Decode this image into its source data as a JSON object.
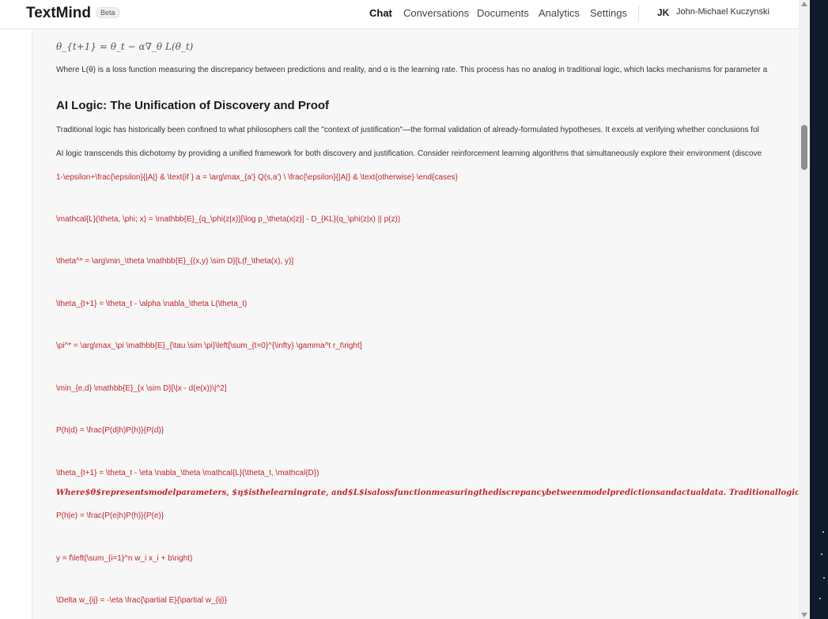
{
  "header": {
    "brand": "TextMind",
    "badge": "Beta",
    "nav": [
      {
        "label": "Chat",
        "active": true
      },
      {
        "label": "Conversations",
        "active": false
      },
      {
        "label": "Documents",
        "active": false
      },
      {
        "label": "Analytics",
        "active": false
      },
      {
        "label": "Settings",
        "active": false
      }
    ],
    "user_initials": "JK",
    "user_name": "John-Michael Kuczynski"
  },
  "content": {
    "update_formula": "θ_{t+1} = θ_t − α∇_θ L(θ_t)",
    "para_loss": "Where L(θ) is a loss function measuring the discrepancy between predictions and reality, and α is the learning rate. This process has no analog in traditional logic, which lacks mechanisms for parameter a",
    "heading": "AI Logic: The Unification of Discovery and Proof",
    "para_traditional": "Traditional logic has historically been confined to what philosophers call the \"context of justification\"—the formal validation of already-formulated hypotheses. It excels at verifying whether conclusions fol",
    "para_ai": "AI logic transcends this dichotomy by providing a unified framework for both discovery and justification. Consider reinforcement learning algorithms that simultaneously explore their environment (discove",
    "raw_lines": [
      "1-\\epsilon+\\frac{\\epsilon}{|A|} & \\text{if } a = \\arg\\max_{a'} Q(s,a') \\ \\frac{\\epsilon}{|A|} & \\text{otherwise} \\end{cases}",
      "\\mathcal{L}(\\theta, \\phi; x) = \\mathbb{E}_{q_\\phi(z|x)}[\\log p_\\theta(x|z)] - D_{KL}(q_\\phi(z|x) || p(z))",
      "\\theta^* = \\arg\\min_\\theta \\mathbb{E}_{(x,y) \\sim D}[L(f_\\theta(x), y)]",
      "\\theta_{t+1} = \\theta_t - \\alpha \\nabla_\\theta L(\\theta_t)",
      "\\pi^* = \\arg\\max_\\pi \\mathbb{E}_{\\tau \\sim \\pi}\\left[\\sum_{t=0}^{\\infty} \\gamma^t r_t\\right]",
      "\\min_{e,d} \\mathbb{E}_{x \\sim D}[\\|x - d(e(x))\\|^2]",
      "P(h|d) = \\frac{P(d|h)P(h)}{P(d)}",
      "\\theta_{t+1} = \\theta_t - \\eta \\nabla_\\theta \\mathcal{L}(\\theta_t, \\mathcal{D})"
    ],
    "italic_line": "Where$θ$representsmodelparameters, $η$isthelearningrate, and$L$isalossfunctionmeasuringthediscrepancybetweenmodelpredictionsandactualdata. Traditionallogic'sinabilityto",
    "raw_lines_2": [
      "P(h|e) = \\frac{P(e|h)P(h)}{P(e)}",
      "y = f\\left(\\sum_{i=1}^n w_i x_i + b\\right)",
      "\\Delta w_{ij} = -\\eta \\frac{\\partial E}{\\partial w_{ij}}"
    ]
  },
  "colors": {
    "accent_red": "#c0262c",
    "desktop": "#0f1a2b"
  }
}
